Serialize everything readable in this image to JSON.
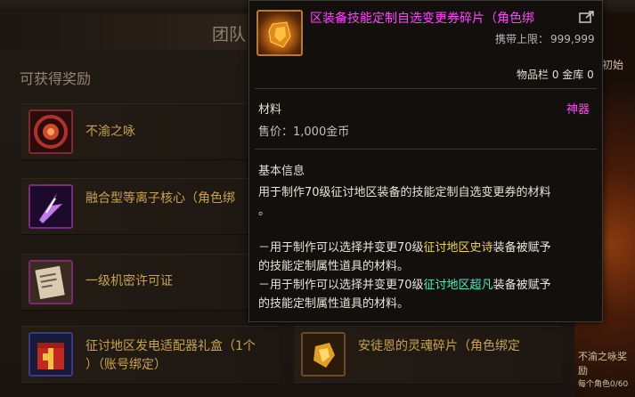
{
  "panel": {
    "title": "团队",
    "section_title": "可获得奖励"
  },
  "rewards": [
    {
      "label_lines": [
        "不渝之咏",
        ""
      ],
      "icon": "red-emblem-icon"
    },
    {
      "label_lines": [
        "融合型等离子核心（角色绑",
        ""
      ],
      "icon": "purple-plasma-core-icon"
    },
    {
      "label_lines": [
        "一级机密许可证",
        ""
      ],
      "icon": "license-document-icon"
    },
    {
      "label_lines": [
        "征讨地区发电适配器礼盒（1个",
        "）（账号绑定）"
      ],
      "icon": "gift-box-icon"
    },
    {
      "label_lines": [
        "安徒恩的灵魂碎片（角色绑定",
        ""
      ],
      "icon": "soul-fragment-icon"
    }
  ],
  "right_side": {
    "first_win": "初始",
    "reward_name": "不渝之咏奖励",
    "count_text": "每个角色0/60"
  },
  "tooltip": {
    "name": "区装备技能定制自选变更券碎片（角色绑",
    "limit_label": "携带上限：",
    "limit_value": "999,999",
    "storage": "物品栏 0 金库 0",
    "category": "材料",
    "rarity": "神器",
    "price": "售价：1,000金币",
    "basic_heading": "基本信息",
    "desc_line1": "用于制作70级征讨地区装备的技能定制自选变更券的材料",
    "desc_line2": "。",
    "bullet1_pre": "－用于制作可以选择并变更70级",
    "bullet1_hl": "征讨地区史诗",
    "bullet1_post": "装备被赋予",
    "bullet1_line2": "的技能定制属性道具的材料。",
    "bullet2_pre": "－用于制作可以选择并变更70级",
    "bullet2_hl": "征讨地区超凡",
    "bullet2_post": "装备被赋予",
    "bullet2_line2": "的技能定制属性道具的材料。",
    "colors": {
      "name": "#ff44ff",
      "epic": "#f3d339",
      "legendary": "#3df0c8"
    }
  }
}
